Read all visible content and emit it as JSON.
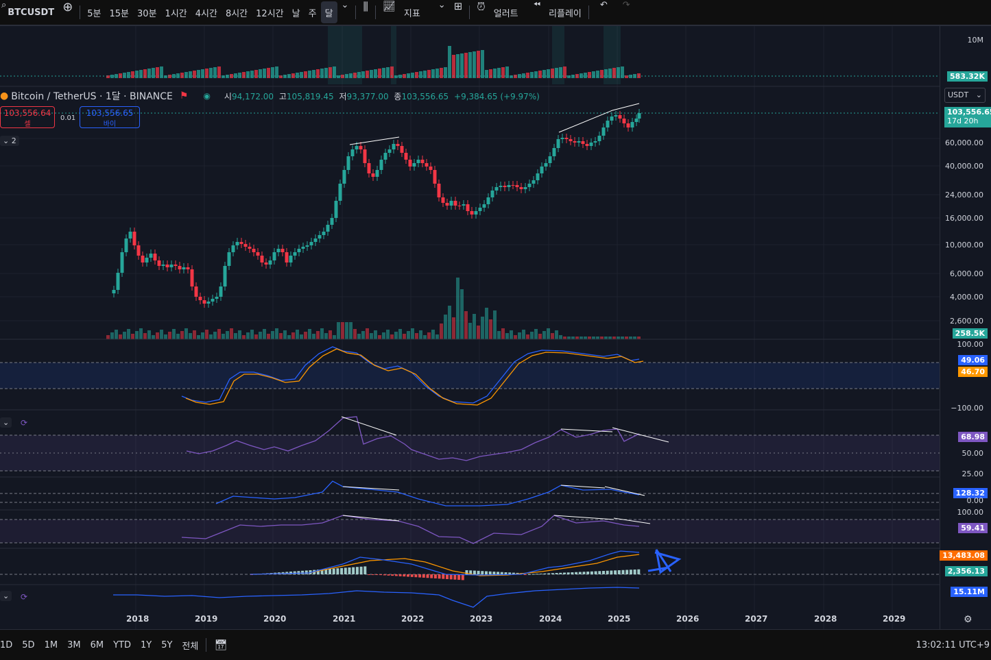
{
  "toolbar": {
    "symbol": "BTCUSDT",
    "intervals": [
      "5분",
      "15분",
      "30분",
      "1시간",
      "4시간",
      "8시간",
      "12시간",
      "날",
      "주",
      "달"
    ],
    "active_interval": "달",
    "indicators_label": "지표",
    "alert_label": "얼러트",
    "replay_label": "리플레이"
  },
  "legend": {
    "title": "Bitcoin / TetherUS · 1달 · BINANCE",
    "open_label": "시",
    "open": "94,172.00",
    "high_label": "고",
    "high": "105,819.45",
    "low_label": "저",
    "low": "93,377.00",
    "close_label": "종",
    "close": "103,556.65",
    "change": "+9,384.65 (+9.97%)",
    "collapse_count": "2"
  },
  "trade": {
    "sell_price": "103,556.64",
    "sell_label": "셀",
    "spread": "0.01",
    "buy_price": "103,556.65",
    "buy_label": "바이"
  },
  "axis": {
    "currency": "USDT",
    "volume_top": "10M",
    "volume_top_value": "583.32K",
    "symbol_tag": "BTCUSDT",
    "price_tag": "103,556.65",
    "countdown": "17d 20h",
    "price_ticks": [
      "60,000.00",
      "40,000.00",
      "24,000.00",
      "16,000.00",
      "10,000.00",
      "6,000.00",
      "4,000.00",
      "2,600.00"
    ],
    "volume_value": "258.5K",
    "osc1_top": "100.00",
    "osc1_bottom": "−100.00",
    "osc1_val1": "49.06",
    "osc1_val2": "46.70",
    "rsi_val": "68.98",
    "rsi_mid": "50.00",
    "rsi_low": "25.00",
    "osc3_val": "128.32",
    "osc3_zero": "0.00",
    "osc4_top": "100.00",
    "osc4_val": "59.41",
    "macd_val1": "13,483.08",
    "macd_val2": "2,356.13",
    "obv_val": "15.11M"
  },
  "x_axis": {
    "years": [
      "2018",
      "2019",
      "2020",
      "2021",
      "2022",
      "2023",
      "2024",
      "2025",
      "2026",
      "2027",
      "2028",
      "2029"
    ]
  },
  "bottombar": {
    "ranges": [
      "1D",
      "5D",
      "1M",
      "3M",
      "6M",
      "YTD",
      "1Y",
      "5Y",
      "전체"
    ],
    "clock": "13:02:11 UTC+9"
  },
  "colors": {
    "up": "#26a69a",
    "down": "#f23645",
    "blue": "#2962ff",
    "orange": "#ff9800",
    "purple": "#7e57c2"
  }
}
